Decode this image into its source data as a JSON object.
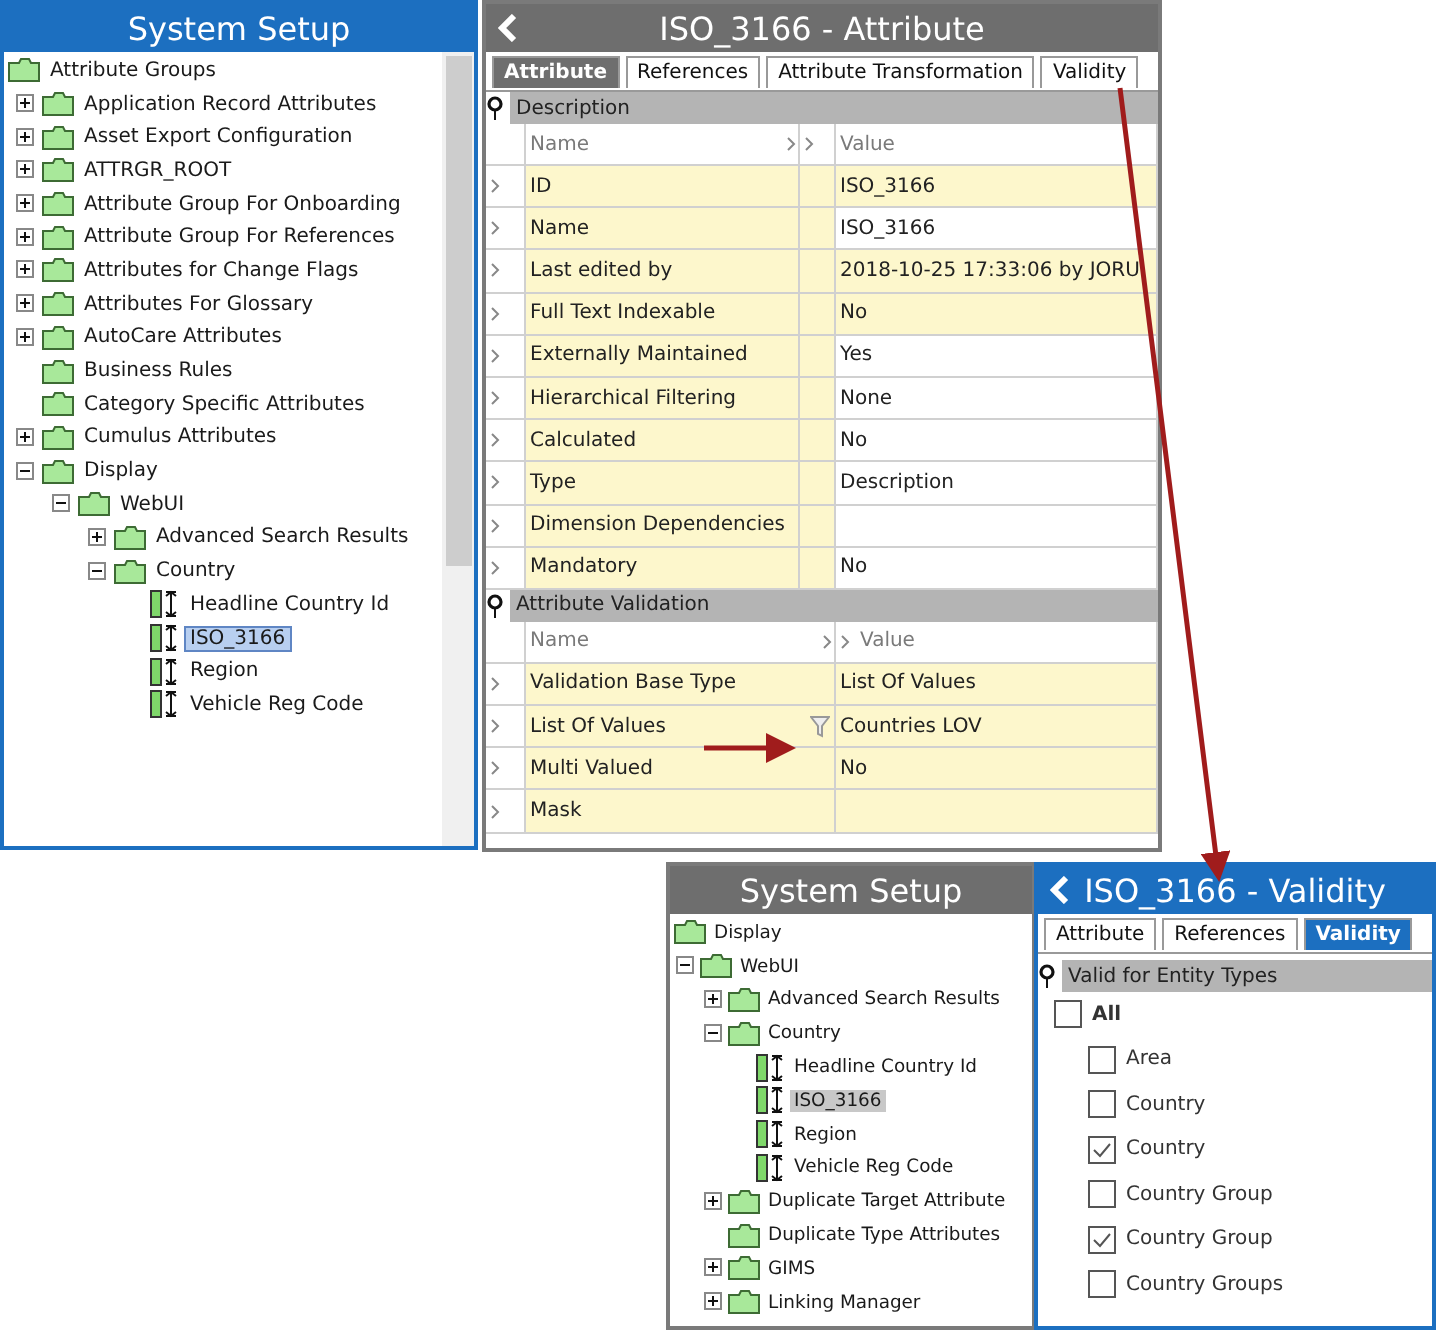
{
  "tree_panel": {
    "title": "System Setup",
    "active": true,
    "tree": [
      {
        "label": "Attribute Groups",
        "kind": "folder",
        "selected": false,
        "children": [
          {
            "label": "Application Record Attributes",
            "kind": "folder",
            "expanded": false,
            "selected": false
          },
          {
            "label": "Asset Export Configuration",
            "kind": "folder",
            "expanded": false,
            "selected": false
          },
          {
            "label": "ATTRGR_ROOT",
            "kind": "folder",
            "expanded": false,
            "selected": false
          },
          {
            "label": "Attribute Group For Onboarding",
            "kind": "folder",
            "expanded": false,
            "selected": false
          },
          {
            "label": "Attribute Group For References",
            "kind": "folder",
            "expanded": false,
            "selected": false
          },
          {
            "label": "Attributes for Change Flags",
            "kind": "folder",
            "expanded": false,
            "selected": false
          },
          {
            "label": "Attributes For Glossary",
            "kind": "folder",
            "expanded": false,
            "selected": false
          },
          {
            "label": "AutoCare Attributes",
            "kind": "folder",
            "expanded": false,
            "selected": false
          },
          {
            "label": "Business Rules",
            "kind": "folder",
            "selected": false
          },
          {
            "label": "Category Specific Attributes",
            "kind": "folder",
            "selected": false
          },
          {
            "label": "Cumulus Attributes",
            "kind": "folder",
            "expanded": false,
            "selected": false
          },
          {
            "label": "Display",
            "kind": "folder",
            "expanded": true,
            "selected": false,
            "children": [
              {
                "label": "WebUI",
                "kind": "folder",
                "expanded": true,
                "selected": false,
                "children": [
                  {
                    "label": "Advanced Search Results",
                    "kind": "folder",
                    "expanded": false,
                    "selected": false
                  },
                  {
                    "label": "Country",
                    "kind": "folder",
                    "expanded": true,
                    "selected": false,
                    "children": [
                      {
                        "label": "Headline Country Id",
                        "kind": "attribute",
                        "selected": false
                      },
                      {
                        "label": "ISO_3166",
                        "kind": "attribute",
                        "selected": true
                      },
                      {
                        "label": "Region",
                        "kind": "attribute",
                        "selected": false
                      },
                      {
                        "label": "Vehicle Reg Code",
                        "kind": "attribute",
                        "selected": false
                      }
                    ]
                  }
                ]
              }
            ]
          }
        ]
      }
    ]
  },
  "attribute_panel": {
    "title": "ISO_3166 - Attribute",
    "active": false,
    "tabs": [
      {
        "label": "Attribute",
        "selected": true
      },
      {
        "label": "References",
        "selected": false
      },
      {
        "label": "Attribute Transformation",
        "selected": false
      },
      {
        "label": "Validity",
        "selected": false
      }
    ],
    "sections": [
      {
        "title": "Description",
        "kind": "three_column",
        "columns": [
          "Name",
          "Value"
        ],
        "rows": [
          {
            "name": "ID",
            "value": "ISO_3166",
            "readonly": true,
            "filter": false
          },
          {
            "name": "Name",
            "value": "ISO_3166",
            "readonly": false,
            "filter": false
          },
          {
            "name": "Last edited by",
            "value": "2018-10-25 17:33:06 by JORU",
            "readonly": true,
            "filter": false
          },
          {
            "name": "Full Text Indexable",
            "value": "No",
            "readonly": true,
            "filter": false
          },
          {
            "name": "Externally Maintained",
            "value": "Yes",
            "readonly": false,
            "filter": false
          },
          {
            "name": "Hierarchical Filtering",
            "value": "None",
            "readonly": false,
            "filter": false
          },
          {
            "name": "Calculated",
            "value": "No",
            "readonly": false,
            "filter": false
          },
          {
            "name": "Type",
            "value": "Description",
            "readonly": false,
            "filter": false
          },
          {
            "name": "Dimension Dependencies",
            "value": "",
            "readonly": false,
            "filter": false
          },
          {
            "name": "Mandatory",
            "value": "No",
            "readonly": false,
            "filter": false
          }
        ]
      },
      {
        "title": "Attribute Validation",
        "kind": "two_column",
        "columns": [
          "Name",
          "Value"
        ],
        "rows": [
          {
            "name": "Validation Base Type",
            "value": "List Of Values",
            "readonly": true,
            "filter": false
          },
          {
            "name": "List Of Values",
            "value": "Countries LOV",
            "readonly": true,
            "filter": true
          },
          {
            "name": "Multi Valued",
            "value": "No",
            "readonly": true,
            "filter": false
          },
          {
            "name": "Mask",
            "value": "",
            "readonly": true,
            "filter": false
          }
        ]
      }
    ]
  },
  "tree_panel_2": {
    "title": "System Setup",
    "active": false,
    "tree": [
      {
        "label": "Display",
        "kind": "folder",
        "selected": false,
        "children": [
          {
            "label": "WebUI",
            "kind": "folder",
            "expanded": true,
            "selected": false,
            "children": [
              {
                "label": "Advanced Search Results",
                "kind": "folder",
                "expanded": false,
                "selected": false
              },
              {
                "label": "Country",
                "kind": "folder",
                "expanded": true,
                "selected": false,
                "children": [
                  {
                    "label": "Headline Country Id",
                    "kind": "attribute",
                    "selected": false
                  },
                  {
                    "label": "ISO_3166",
                    "kind": "attribute",
                    "selected": true
                  },
                  {
                    "label": "Region",
                    "kind": "attribute",
                    "selected": false
                  },
                  {
                    "label": "Vehicle Reg Code",
                    "kind": "attribute",
                    "selected": false
                  }
                ]
              },
              {
                "label": "Duplicate Target Attribute",
                "kind": "folder",
                "expanded": false,
                "selected": false
              },
              {
                "label": "Duplicate Type Attributes",
                "kind": "folder",
                "selected": false
              },
              {
                "label": "GIMS",
                "kind": "folder",
                "expanded": false,
                "selected": false
              },
              {
                "label": "Linking Manager",
                "kind": "folder",
                "expanded": false,
                "selected": false
              }
            ]
          }
        ]
      }
    ]
  },
  "validity_panel": {
    "title": "ISO_3166 - Validity",
    "active": true,
    "tabs": [
      {
        "label": "Attribute",
        "selected": false
      },
      {
        "label": "References",
        "selected": false
      },
      {
        "label": "Validity",
        "selected": true
      }
    ],
    "section": "Valid for Entity Types",
    "all": {
      "label": "All",
      "checked": false
    },
    "entity_types": [
      {
        "label": "Area",
        "checked": false
      },
      {
        "label": "Country",
        "checked": false
      },
      {
        "label": "Country",
        "checked": true
      },
      {
        "label": "Country Group",
        "checked": false
      },
      {
        "label": "Country Group",
        "checked": true
      },
      {
        "label": "Country Groups",
        "checked": false
      }
    ]
  }
}
